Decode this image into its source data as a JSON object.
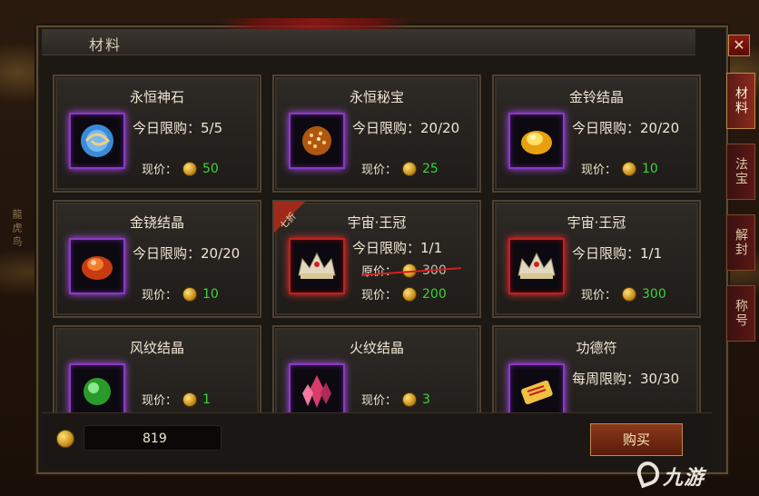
{
  "window": {
    "title": "材料",
    "close_label": "✕"
  },
  "side_tabs": [
    {
      "label": "材料",
      "active": true
    },
    {
      "label": "法宝",
      "active": false
    },
    {
      "label": "解封",
      "active": false
    },
    {
      "label": "称号",
      "active": false
    }
  ],
  "labels": {
    "limit_daily": "今日限购：",
    "limit_weekly": "每周限购：",
    "current_price": "现价：",
    "original_price": "原价：",
    "discount": "七折"
  },
  "items": [
    {
      "name": "永恒神石",
      "limit": "今日限购：5/5",
      "price": "50",
      "icon": "swirl-orb-icon"
    },
    {
      "name": "永恒秘宝",
      "limit": "今日限购：20/20",
      "price": "25",
      "icon": "sparkle-burst-icon"
    },
    {
      "name": "金铃结晶",
      "limit": "今日限购：20/20",
      "price": "10",
      "icon": "gold-crystal-icon"
    },
    {
      "name": "金铙结晶",
      "limit": "今日限购：20/20",
      "price": "10",
      "icon": "orange-crystal-icon"
    },
    {
      "name": "宇宙·王冠",
      "limit": "今日限购：1/1",
      "original_price": "300",
      "price": "200",
      "icon": "crown-icon",
      "discount": true
    },
    {
      "name": "宇宙·王冠",
      "limit": "今日限购：1/1",
      "price": "300",
      "icon": "crown-icon"
    },
    {
      "name": "风纹结晶",
      "price": "1",
      "icon": "green-gem-icon"
    },
    {
      "name": "火纹结晶",
      "price": "3",
      "icon": "pink-crystal-icon"
    },
    {
      "name": "功德符",
      "limit": "每周限购：30/30",
      "icon": "scroll-icon"
    }
  ],
  "bottom": {
    "balance": "819",
    "buy_label": "购买"
  },
  "watermark": "九游",
  "colors": {
    "price_green": "#3ad43a",
    "strike_red": "#d02020",
    "active_tab": "#8a2a1e"
  }
}
